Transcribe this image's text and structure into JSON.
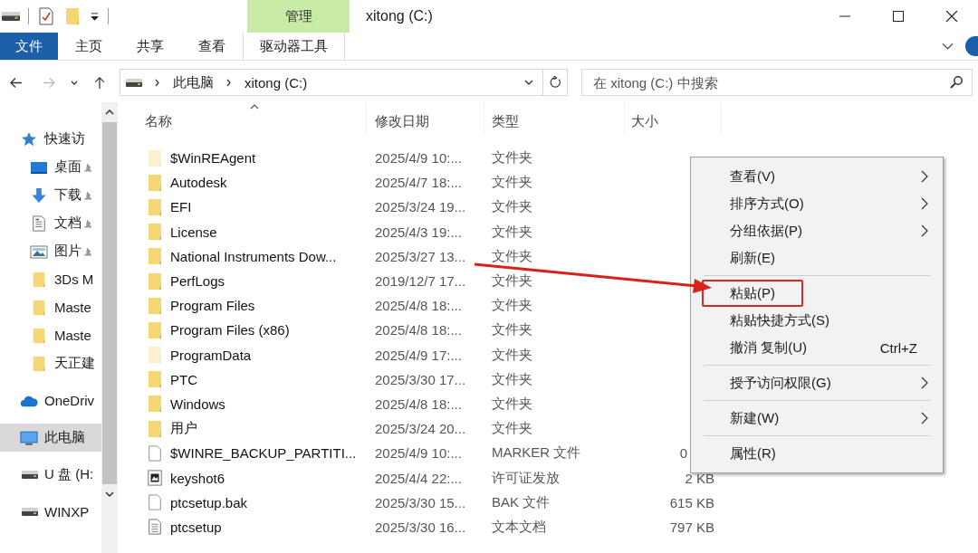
{
  "window": {
    "title": "xitong (C:)",
    "tool_tab": "管理"
  },
  "ribbon": {
    "tabs": [
      {
        "label": "文件",
        "kind": "file"
      },
      {
        "label": "主页",
        "kind": "tab"
      },
      {
        "label": "共享",
        "kind": "tab"
      },
      {
        "label": "查看",
        "kind": "tab"
      },
      {
        "label": "驱动器工具",
        "kind": "contextual"
      }
    ]
  },
  "address": {
    "path": [
      "此电脑",
      "xitong (C:)"
    ]
  },
  "search": {
    "placeholder": "在 xitong (C:) 中搜索"
  },
  "sidebar": {
    "items": [
      {
        "label": "快速访",
        "kind": "star",
        "selected": false,
        "children": [
          {
            "label": "桌面",
            "kind": "desktop",
            "pinned": true,
            "selected": false
          },
          {
            "label": "下载",
            "kind": "download",
            "pinned": true,
            "selected": false
          },
          {
            "label": "文档",
            "kind": "document",
            "pinned": true,
            "selected": false
          },
          {
            "label": "图片",
            "kind": "pictures",
            "pinned": true,
            "selected": false
          },
          {
            "label": "3Ds M",
            "kind": "folder",
            "pinned": false,
            "selected": false
          },
          {
            "label": "Maste",
            "kind": "folder",
            "pinned": false,
            "selected": false
          },
          {
            "label": "Maste",
            "kind": "folder",
            "pinned": false,
            "selected": false
          },
          {
            "label": "天正建",
            "kind": "folder",
            "pinned": false,
            "selected": false
          }
        ]
      },
      {
        "label": "OneDriv",
        "kind": "cloud",
        "selected": false
      },
      {
        "label": "此电脑",
        "kind": "computer",
        "selected": true
      },
      {
        "label": "U 盘 (H:",
        "kind": "drive",
        "selected": false
      },
      {
        "label": "WINXP",
        "kind": "drive",
        "selected": false
      }
    ]
  },
  "file_list": {
    "columns": [
      {
        "label": "名称",
        "sorted": true
      },
      {
        "label": "修改日期",
        "sorted": false
      },
      {
        "label": "类型",
        "sorted": false
      },
      {
        "label": "大小",
        "sorted": false
      }
    ],
    "rows": [
      {
        "name": "$WinREAgent",
        "date": "2025/4/9 10:...",
        "type": "文件夹",
        "kind": "folder",
        "hidden": true
      },
      {
        "name": "Autodesk",
        "date": "2025/4/7 18:...",
        "type": "文件夹",
        "kind": "folder",
        "hidden": false
      },
      {
        "name": "EFI",
        "date": "2025/3/24 19...",
        "type": "文件夹",
        "kind": "folder",
        "hidden": false
      },
      {
        "name": "License",
        "date": "2025/4/3 19:...",
        "type": "文件夹",
        "kind": "folder",
        "hidden": false
      },
      {
        "name": "National Instruments Dow...",
        "date": "2025/3/27 13...",
        "type": "文件夹",
        "kind": "folder",
        "hidden": false
      },
      {
        "name": "PerfLogs",
        "date": "2019/12/7 17...",
        "type": "文件夹",
        "kind": "folder",
        "hidden": false
      },
      {
        "name": "Program Files",
        "date": "2025/4/8 18:...",
        "type": "文件夹",
        "kind": "folder",
        "hidden": false
      },
      {
        "name": "Program Files (x86)",
        "date": "2025/4/8 18:...",
        "type": "文件夹",
        "kind": "folder",
        "hidden": false
      },
      {
        "name": "ProgramData",
        "date": "2025/4/9 17:...",
        "type": "文件夹",
        "kind": "folder",
        "hidden": true
      },
      {
        "name": "PTC",
        "date": "2025/3/30 17...",
        "type": "文件夹",
        "kind": "folder",
        "hidden": false
      },
      {
        "name": "Windows",
        "date": "2025/4/8 18:...",
        "type": "文件夹",
        "kind": "folder",
        "hidden": false
      },
      {
        "name": "用户",
        "date": "2025/3/24 20...",
        "type": "文件夹",
        "kind": "folder",
        "hidden": false
      },
      {
        "name": "$WINRE_BACKUP_PARTITI...",
        "date": "2025/4/9 10:...",
        "type": "MARKER 文件",
        "size": "0",
        "kind": "file",
        "hidden": false
      },
      {
        "name": "keyshot6",
        "date": "2025/4/4 22:...",
        "type": "许可证发放",
        "size": "2 KB",
        "kind": "image",
        "hidden": false
      },
      {
        "name": "ptcsetup.bak",
        "date": "2025/3/30 15...",
        "type": "BAK 文件",
        "size": "615 KB",
        "kind": "file",
        "hidden": false
      },
      {
        "name": "ptcsetup",
        "date": "2025/3/30 16...",
        "type": "文本文档",
        "size": "797 KB",
        "kind": "text",
        "hidden": false
      }
    ]
  },
  "context_menu": {
    "items": [
      {
        "kind": "item",
        "label": "查看(V)",
        "submenu": true,
        "highlighted": false
      },
      {
        "kind": "item",
        "label": "排序方式(O)",
        "submenu": true,
        "highlighted": false
      },
      {
        "kind": "item",
        "label": "分组依据(P)",
        "submenu": true,
        "highlighted": false
      },
      {
        "kind": "item",
        "label": "刷新(E)",
        "submenu": false,
        "highlighted": false
      },
      {
        "kind": "separator"
      },
      {
        "kind": "item",
        "label": "粘贴(P)",
        "submenu": false,
        "highlighted": true
      },
      {
        "kind": "item",
        "label": "粘贴快捷方式(S)",
        "submenu": false,
        "highlighted": false
      },
      {
        "kind": "item",
        "label": "撤消 复制(U)",
        "submenu": false,
        "highlighted": false,
        "shortcut": "Ctrl+Z"
      },
      {
        "kind": "separator"
      },
      {
        "kind": "item",
        "label": "授予访问权限(G)",
        "submenu": true,
        "highlighted": false
      },
      {
        "kind": "separator"
      },
      {
        "kind": "item",
        "label": "新建(W)",
        "submenu": true,
        "highlighted": false
      },
      {
        "kind": "separator"
      },
      {
        "kind": "item",
        "label": "属性(R)",
        "submenu": false,
        "highlighted": false
      }
    ]
  }
}
